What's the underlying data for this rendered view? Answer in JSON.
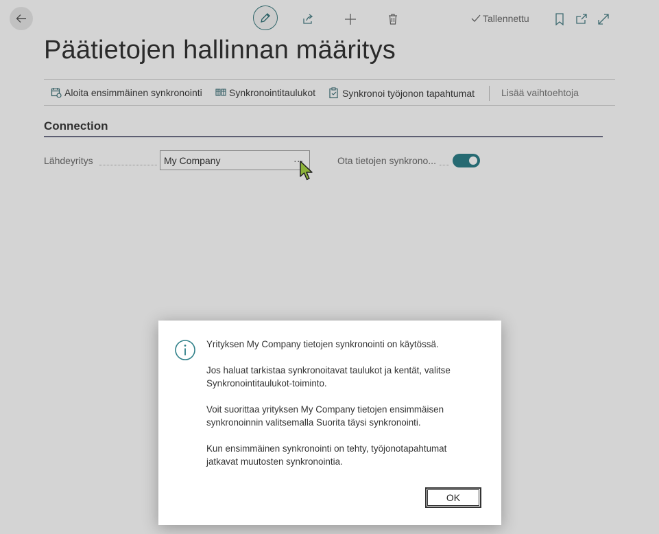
{
  "topbar": {
    "saved_label": "Tallennettu"
  },
  "page": {
    "title": "Päätietojen hallinnan määritys"
  },
  "actions": {
    "start_sync": "Aloita ensimmäinen synkronointi",
    "sync_tables": "Synkronointitaulukot",
    "sync_job_queue": "Synkronoi työjonon tapahtumat",
    "more_options": "Lisää vaihtoehtoja"
  },
  "section": {
    "title": "Connection"
  },
  "fields": {
    "source_company_label": "Lähdeyritys",
    "source_company_value": "My Company",
    "lookup": "...",
    "enable_sync_label": "Ota tietojen synkrono...",
    "enable_sync_on": true
  },
  "dialog": {
    "line1": "Yrityksen My Company tietojen synkronointi on käytössä.",
    "para2_l1": "Jos haluat tarkistaa synkronoitavat taulukot ja kentät, valitse",
    "para2_l2": "Synkronointitaulukot-toiminto.",
    "para3_l1": "Voit suorittaa yrityksen My Company tietojen ensimmäisen",
    "para3_l2": "synkronoinnin valitsemalla Suorita täysi synkronointi.",
    "para4_l1": "Kun ensimmäinen synkronointi on tehty, työjonotapahtumat",
    "para4_l2": "jatkavat muutosten synkronointia.",
    "ok_label": "OK"
  },
  "colors": {
    "accent": "#2e7f88",
    "section_line": "#6f7088"
  }
}
